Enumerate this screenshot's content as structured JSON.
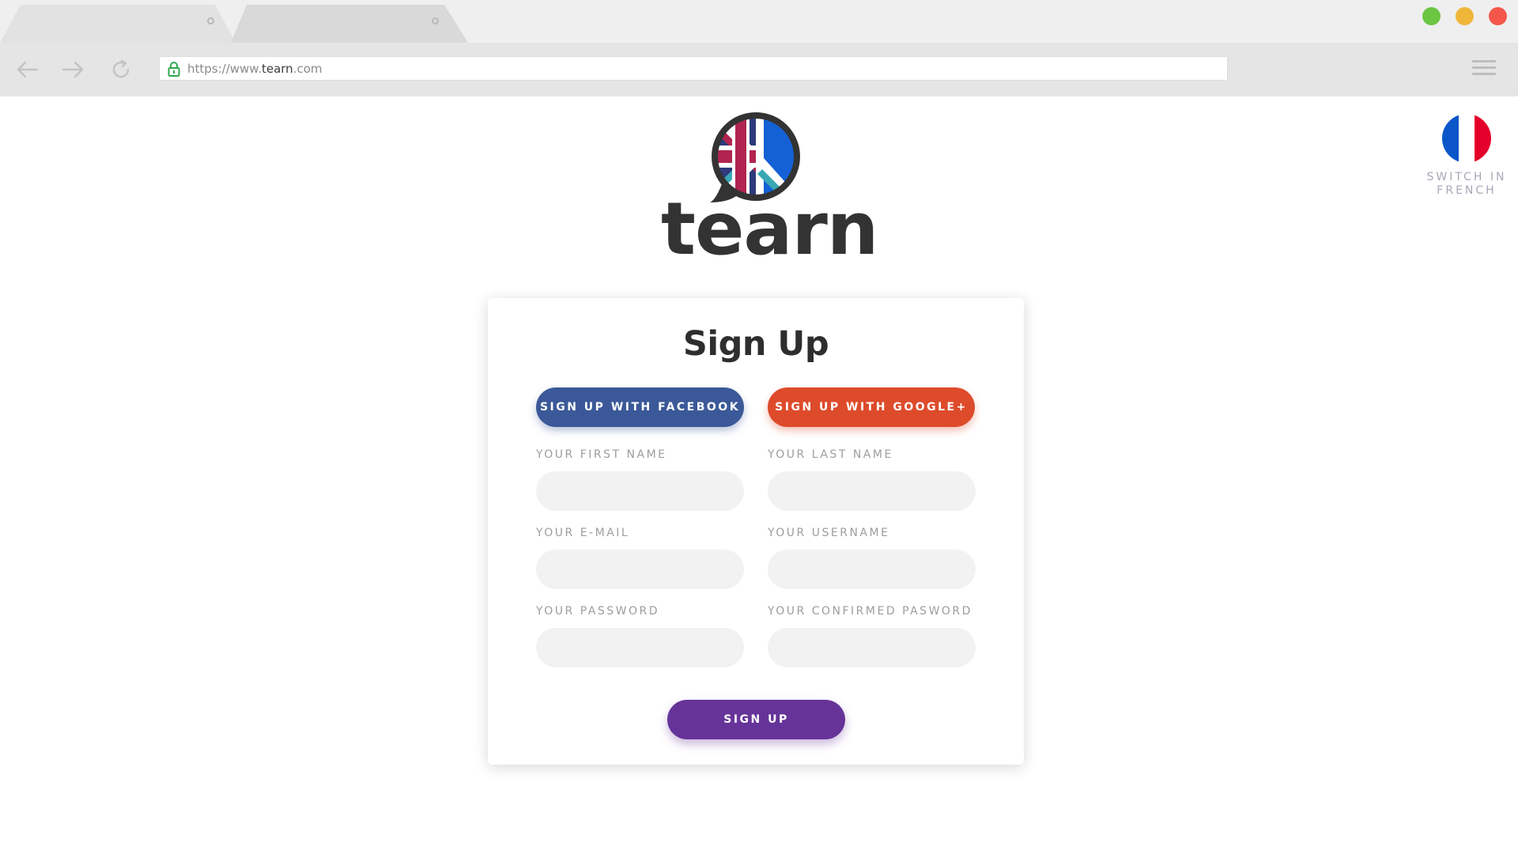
{
  "browser": {
    "url_prefix": "https://www.",
    "url_domain": "tearn",
    "url_suffix": ".com",
    "window_dots": [
      "#6cc644",
      "#f0b63a",
      "#f5564a"
    ]
  },
  "brand": {
    "logo_text": "tearn",
    "colors": {
      "navy": "#2d3a7c",
      "crimson": "#b0244f",
      "teal": "#3aa7b5",
      "blue": "#1461d6"
    }
  },
  "language_switch": {
    "label": "SWITCH IN FRENCH",
    "flag_colors": [
      "#0b57c9",
      "#ffffff",
      "#e4002b"
    ]
  },
  "form": {
    "title": "Sign Up",
    "facebook_button": "SIGN UP WITH FACEBOOK",
    "google_button": "SIGN UP WITH GOOGLE+",
    "fields": {
      "first_name": "YOUR FIRST NAME",
      "last_name": "YOUR LAST NAME",
      "email": "YOUR E-MAIL",
      "username": "YOUR USERNAME",
      "password": "YOUR PASSWORD",
      "confirm_password": "YOUR CONFIRMED PASWORD"
    },
    "submit_button": "SIGN UP",
    "colors": {
      "facebook": "#3b5998",
      "google": "#dd4b2b",
      "submit": "#663399"
    }
  }
}
